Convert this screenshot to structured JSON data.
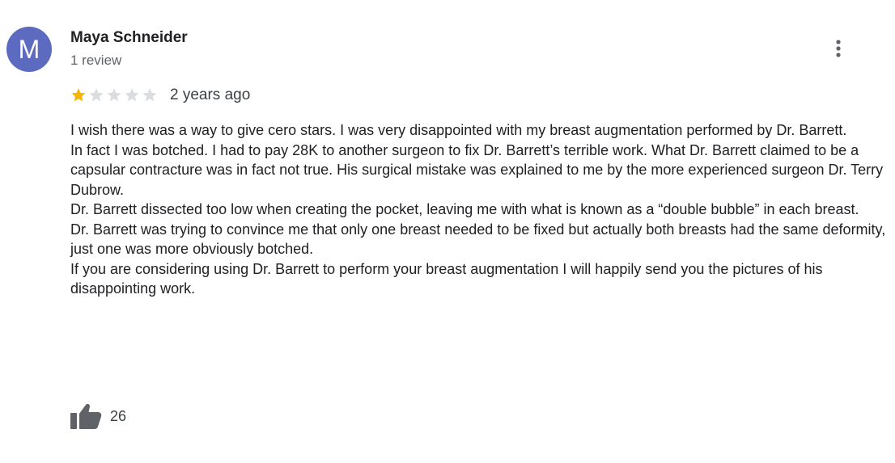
{
  "review": {
    "author": {
      "initial": "M",
      "name": "Maya Schneider",
      "review_count": "1 review",
      "avatar_color": "#5c6bc0"
    },
    "menu_icon": "more-vert-icon",
    "rating": {
      "stars": 1,
      "max_stars": 5,
      "filled_color": "#f4b400",
      "empty_color": "#dadce0"
    },
    "date": "2 years ago",
    "paragraphs": [
      "I wish there was a way to give cero stars. I was very disappointed with my breast augmentation performed by Dr. Barrett.",
      "In fact I was botched. I had to pay 28K to another surgeon to fix Dr. Barrett’s terrible work. What Dr. Barrett claimed to be a capsular contracture was in fact not true. His surgical mistake was explained to me by the more experienced surgeon Dr. Terry Dubrow.",
      "Dr. Barrett dissected too low when creating the pocket, leaving me with what is known as a “double bubble” in each breast.",
      "Dr. Barrett was trying to convince me that only one breast needed to be fixed but actually both breasts had the same deformity,  just one was more obviously botched.",
      "If you are considering using Dr. Barrett to perform your breast augmentation I will happily send you the pictures of his disappointing work."
    ],
    "likes": {
      "icon": "thumbs-up-icon",
      "count": "26"
    }
  }
}
